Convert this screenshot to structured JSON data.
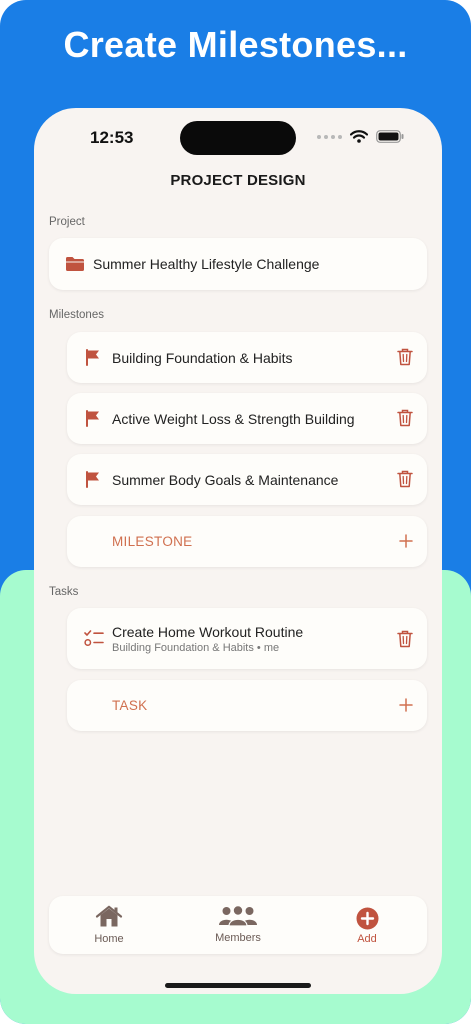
{
  "headline": "Create Milestones...",
  "status_bar": {
    "time": "12:53"
  },
  "screen": {
    "title": "PROJECT DESIGN"
  },
  "project": {
    "section_label": "Project",
    "name": "Summer Healthy Lifestyle Challenge"
  },
  "milestones": {
    "section_label": "Milestones",
    "items": [
      {
        "label": "Building Foundation & Habits"
      },
      {
        "label": "Active Weight Loss & Strength Building"
      },
      {
        "label": "Summer Body Goals & Maintenance"
      }
    ],
    "add_label": "MILESTONE"
  },
  "tasks": {
    "section_label": "Tasks",
    "items": [
      {
        "label": "Create Home Workout Routine",
        "subtitle": "Building Foundation & Habits • me"
      }
    ],
    "add_label": "TASK"
  },
  "tab_bar": {
    "home": "Home",
    "members": "Members",
    "add": "Add"
  },
  "colors": {
    "accent": "#c0533f",
    "accent_text": "#d0704f",
    "background_top": "#1a7ee6",
    "background_bottom": "#a6fbcf",
    "screen_bg": "#f8f4f1"
  },
  "icons": {
    "project": "folder-icon",
    "milestone": "flag-icon",
    "task": "checklist-icon",
    "delete": "trash-icon",
    "add": "plus-icon"
  }
}
